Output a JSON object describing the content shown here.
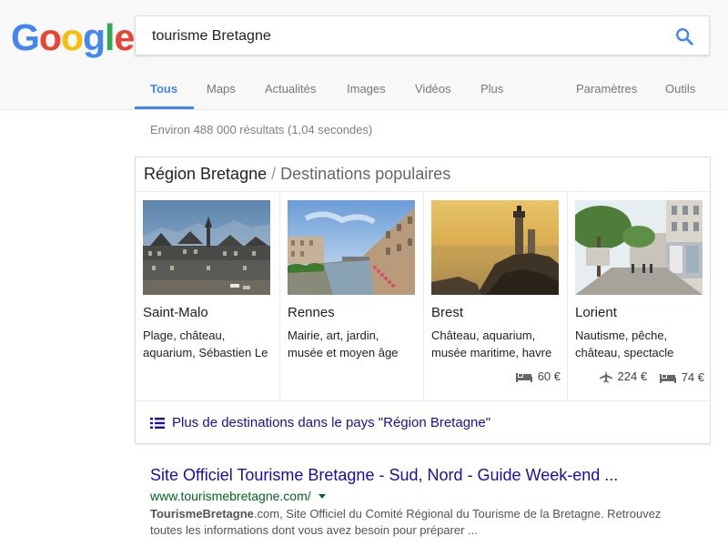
{
  "logo": {
    "letters": [
      "G",
      "o",
      "o",
      "g",
      "l",
      "e"
    ],
    "colors": [
      "#4285f4",
      "#ea4335",
      "#fbbc05",
      "#4285f4",
      "#34a853",
      "#ea4335"
    ]
  },
  "search": {
    "value": "tourisme Bretagne",
    "icon": "search-icon",
    "icon_color": "#4285f4"
  },
  "tabs": [
    {
      "label": "Tous",
      "active": true
    },
    {
      "label": "Maps"
    },
    {
      "label": "Actualités"
    },
    {
      "label": "Images"
    },
    {
      "label": "Vidéos"
    },
    {
      "label": "Plus"
    },
    {
      "label": "Paramètres"
    },
    {
      "label": "Outils"
    }
  ],
  "stats": "Environ 488 000 résultats (1,04 secondes)",
  "knowledge_panel": {
    "title": "Région Bretagne",
    "separator": "/",
    "subtitle": "Destinations populaires",
    "destinations": [
      {
        "name": "Saint-Malo",
        "description": "Plage, château, aquarium, Sébastien Le",
        "image": "saint-malo-photo"
      },
      {
        "name": "Rennes",
        "description": "Mairie, art, jardin, musée et moyen âge",
        "image": "rennes-photo"
      },
      {
        "name": "Brest",
        "description": "Château, aquarium, musée maritime, havre",
        "image": "brest-photo",
        "hotel_price": "60 €"
      },
      {
        "name": "Lorient",
        "description": "Nautisme, pêche, château, spectacle",
        "image": "lorient-photo",
        "flight_price": "224 €",
        "hotel_price": "74 €"
      }
    ],
    "more_link": "Plus de destinations dans le pays \"Région Bretagne\"",
    "more_icon": "list-icon"
  },
  "result": {
    "title": "Site Officiel Tourisme Bretagne - Sud, Nord - Guide Week-end ...",
    "url": "www.tourismebretagne.com/",
    "snippet_bold": "TourismeBretagne",
    "snippet_rest": ".com, Site Officiel du Comité Régional du Tourisme de la Bretagne. Retrouvez toutes les informations dont vous avez besoin pour préparer ..."
  }
}
